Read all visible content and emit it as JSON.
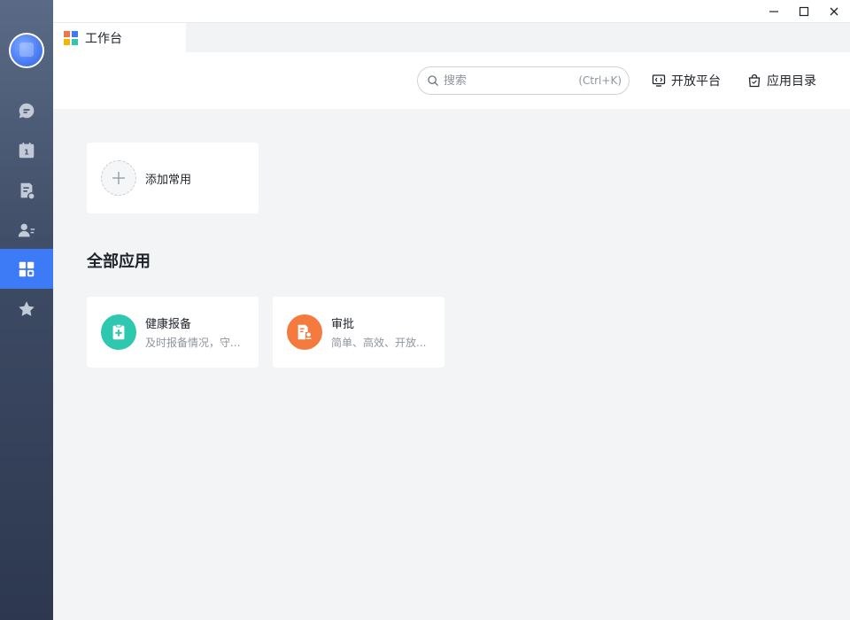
{
  "window": {
    "controls": [
      "minimize",
      "maximize",
      "close"
    ]
  },
  "tab": {
    "label": "工作台"
  },
  "search": {
    "placeholder": "搜索",
    "shortcut": "(Ctrl+K)"
  },
  "header": {
    "open_platform": "开放平台",
    "app_directory": "应用目录"
  },
  "sidebar": {
    "items": [
      {
        "icon": "chat-icon",
        "active": false
      },
      {
        "icon": "calendar-icon",
        "active": false,
        "badge_text": "1"
      },
      {
        "icon": "docs-icon",
        "active": false
      },
      {
        "icon": "contacts-icon",
        "active": false
      },
      {
        "icon": "workbench-icon",
        "active": true
      },
      {
        "icon": "star-icon",
        "active": false
      }
    ],
    "active_color": "#3d7bf6"
  },
  "main": {
    "add_common_label": "添加常用",
    "section_title": "全部应用",
    "apps": [
      {
        "name": "健康报备",
        "desc": "及时报备情况，守...",
        "icon": "health-report-icon",
        "color": "#2ec7b0"
      },
      {
        "name": "审批",
        "desc": "简单、高效、开放...",
        "icon": "approval-icon",
        "color": "#f57a3d"
      }
    ]
  }
}
